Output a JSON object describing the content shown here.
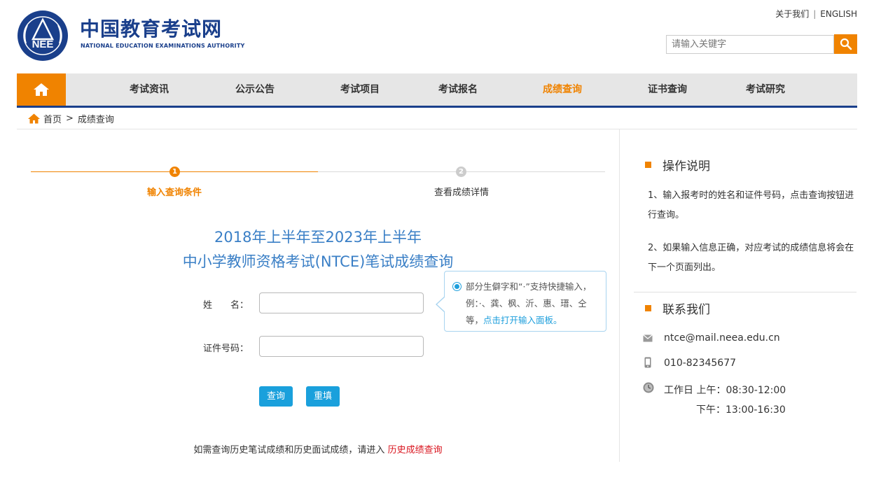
{
  "header": {
    "logo_text": "NEE",
    "site_name_cn": "中国教育考试网",
    "site_name_en": "NATIONAL EDUCATION EXAMINATIONS AUTHORITY",
    "about_link": "关于我们",
    "separator": "|",
    "english_link": "ENGLISH",
    "search_placeholder": "请输入关键字"
  },
  "nav": {
    "items": [
      {
        "label": "考试资讯"
      },
      {
        "label": "公示公告"
      },
      {
        "label": "考试项目"
      },
      {
        "label": "考试报名"
      },
      {
        "label": "成绩查询",
        "active": true
      },
      {
        "label": "证书查询"
      },
      {
        "label": "考试研究"
      }
    ]
  },
  "breadcrumb": {
    "home": "首页",
    "separator": ">",
    "current": "成绩查询"
  },
  "steps": [
    {
      "number": "1",
      "label": "输入查询条件",
      "active": true
    },
    {
      "number": "2",
      "label": "查看成绩详情",
      "active": false
    }
  ],
  "title": {
    "line1": "2018年上半年至2023年上半年",
    "line2": "中小学教师资格考试(NTCE)笔试成绩查询"
  },
  "form": {
    "name_label": "姓　　名：",
    "id_label": "证件号码：",
    "name_value": "",
    "id_value": "",
    "tip_text": "部分生僻字和“·”支持快捷输入，例：·、龚、枫、沂、惠、瑨、仝等，",
    "tip_link": "点击打开输入面板。",
    "query_button": "查询",
    "reset_button": "重填"
  },
  "history": {
    "text": "如需查询历史笔试成绩和历史面试成绩，请进入",
    "link": "历史成绩查询"
  },
  "sidebar": {
    "instructions_title": "操作说明",
    "instruction_1": "1、输入报考时的姓名和证件号码，点击查询按钮进行查询。",
    "instruction_2": "2、如果输入信息正确，对应考试的成绩信息将会在下一个页面列出。",
    "contact_title": "联系我们",
    "email": "ntce@mail.neea.edu.cn",
    "phone": "010-82345677",
    "hours_morning": "工作日 上午：08:30-12:00",
    "hours_afternoon": "下午：13:00-16:30"
  },
  "colors": {
    "brand_blue": "#1a3f8b",
    "accent_orange": "#f08300",
    "title_blue": "#3a7fc6",
    "button_blue": "#1aa0dc",
    "link_red": "#d9141e"
  }
}
